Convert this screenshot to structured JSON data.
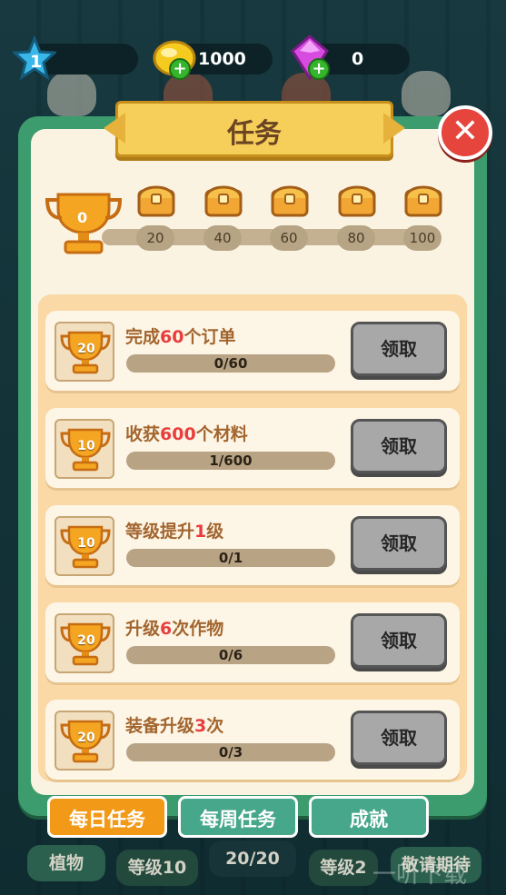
{
  "resources": {
    "level": "1",
    "gold": "1000",
    "gems": "0"
  },
  "dialog": {
    "title": "任务",
    "trophy_points": "0",
    "milestones": [
      "20",
      "40",
      "60",
      "80",
      "100"
    ]
  },
  "tasks": [
    {
      "pre": "完成",
      "num": "60",
      "post": "个订单",
      "progress": "0/60",
      "reward": "20",
      "button": "领取"
    },
    {
      "pre": "收获",
      "num": "600",
      "post": "个材料",
      "progress": "1/600",
      "reward": "10",
      "button": "领取"
    },
    {
      "pre": "等级提升",
      "num": "1",
      "post": "级",
      "progress": "0/1",
      "reward": "10",
      "button": "领取"
    },
    {
      "pre": "升级",
      "num": "6",
      "post": "次作物",
      "progress": "0/6",
      "reward": "20",
      "button": "领取"
    },
    {
      "pre": "装备升级",
      "num": "3",
      "post": "次",
      "progress": "0/3",
      "reward": "20",
      "button": "领取"
    }
  ],
  "tabs": {
    "daily": "每日任务",
    "weekly": "每周任务",
    "achievements": "成就"
  },
  "background": {
    "plants": "植物",
    "level10": "等级10",
    "count": "20/20",
    "level_partial": "等级2",
    "coming_soon": "敬请期待"
  },
  "watermark": "一听下载",
  "colors": {
    "panel_green": "#3c9c6e",
    "tab_active": "#f29a17",
    "highlight_red": "#ea3d3d"
  }
}
